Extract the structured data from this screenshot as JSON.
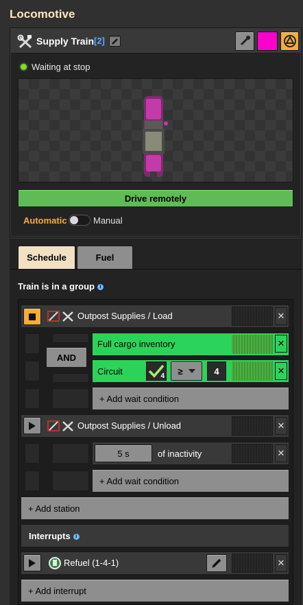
{
  "window": {
    "title": "Locomotive"
  },
  "train": {
    "name": "Supply Train",
    "group_count": "[2]",
    "status": "Waiting at stop",
    "color": "#ff00cc",
    "drive_remotely": "Drive remotely",
    "mode_automatic": "Automatic",
    "mode_manual": "Manual",
    "mode_selected": "Automatic"
  },
  "tabs": [
    {
      "label": "Schedule",
      "active": true
    },
    {
      "label": "Fuel",
      "active": false
    }
  ],
  "schedule": {
    "group_text": "Train is in a group",
    "stations": [
      {
        "name": "Outpost Supplies / Load",
        "state": "active",
        "logic": "AND",
        "conditions": [
          {
            "label": "Full cargo inventory"
          },
          {
            "label": "Circuit",
            "signal_count": "4",
            "comparator": "≥",
            "constant": "4"
          }
        ],
        "add_wait": "+ Add wait condition"
      },
      {
        "name": "Outpost Supplies / Unload",
        "state": "inactive",
        "conditions": [
          {
            "value": "5 s",
            "label": "of inactivity"
          }
        ],
        "add_wait": "+ Add wait condition"
      }
    ],
    "add_station": "+ Add station",
    "interrupts_label": "Interrupts",
    "interrupts": [
      {
        "name": "Refuel (1-4-1)"
      }
    ],
    "add_interrupt": "+ Add interrupt"
  },
  "colors": {
    "status_green": "#7ddb2d",
    "accent_orange": "#f5ac3b",
    "progress_green": "#2cd35b",
    "group_blue": "#58a8ff"
  },
  "icons": {
    "tools": "crossed-tools-icon",
    "rename": "pencil-icon",
    "picker": "color-picker-icon",
    "circuit": "circuit-network-icon",
    "play": "play-icon",
    "stop": "stop-icon",
    "close": "close-icon",
    "fuel_station": "fuel-station-icon",
    "info": "info-icon"
  }
}
